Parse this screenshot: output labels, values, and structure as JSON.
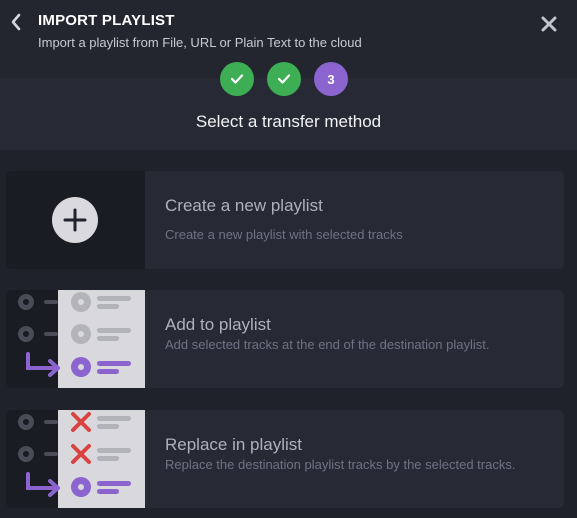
{
  "header": {
    "title": "IMPORT PLAYLIST",
    "subtitle": "Import a playlist from File, URL or Plain Text to the cloud",
    "back_icon": "chevron-left-icon",
    "close_icon": "close-icon"
  },
  "steps": [
    {
      "state": "done",
      "icon": "checkmark-icon"
    },
    {
      "state": "done",
      "icon": "checkmark-icon"
    },
    {
      "state": "active",
      "label": "3"
    }
  ],
  "section_title": "Select a transfer method",
  "options": [
    {
      "label": "Create a new playlist",
      "description": "Create a new playlist with selected tracks",
      "icon": "plus-icon"
    },
    {
      "label": "Add to playlist",
      "description": "Add selected tracks at the end of the destination playlist.",
      "icon": "add-to-playlist-illustration"
    },
    {
      "label": "Replace in playlist",
      "description": "Replace the destination playlist tracks by the selected tracks.",
      "icon": "replace-playlist-illustration"
    }
  ],
  "colors": {
    "step_done": "#3dae54",
    "step_active": "#8b64cf",
    "background": "#1f212b",
    "card": "#272a35",
    "remove_mark": "#d9423f"
  }
}
